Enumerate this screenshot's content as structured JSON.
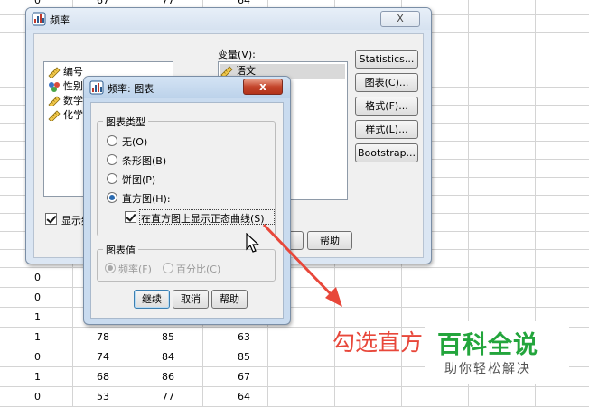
{
  "spreadsheet": {
    "top_partial": [
      "0",
      "67",
      "77",
      "64"
    ],
    "rows": [
      [
        "0",
        "",
        "",
        ""
      ],
      [
        "0",
        "",
        "",
        ""
      ],
      [
        "1",
        "",
        "",
        ""
      ],
      [
        "1",
        "78",
        "85",
        "63"
      ],
      [
        "0",
        "74",
        "84",
        "85"
      ],
      [
        "1",
        "68",
        "86",
        "67"
      ],
      [
        "0",
        "53",
        "77",
        "64"
      ]
    ]
  },
  "frequency_dialog": {
    "title": "频率",
    "close_label": "X",
    "source_vars": [
      {
        "label": "编号",
        "icon": "ruler-icon"
      },
      {
        "label": "性别",
        "icon": "nominal-icon"
      },
      {
        "label": "数学",
        "icon": "ruler-icon"
      },
      {
        "label": "化学",
        "icon": "ruler-icon"
      }
    ],
    "variables_label": "变量(V):",
    "target_vars": [
      {
        "label": "语文",
        "icon": "ruler-icon"
      }
    ],
    "side_buttons": [
      "Statistics...",
      "图表(C)...",
      "格式(F)...",
      "样式(L)...",
      "Bootstrap..."
    ],
    "show_freq_checkbox_label": "显示频",
    "help_label": "帮助"
  },
  "chart_dialog": {
    "title": "频率: 图表",
    "close_label": "x",
    "chart_type_group": "图表类型",
    "options": [
      {
        "label": "无(O)",
        "checked": false
      },
      {
        "label": "条形图(B)",
        "checked": false
      },
      {
        "label": "饼图(P)",
        "checked": false
      },
      {
        "label": "直方图(H):",
        "checked": true
      }
    ],
    "normal_curve_label": "在直方图上显示正态曲线(S)",
    "chart_values_group": "图表值",
    "value_options": [
      {
        "label": "频率(F)",
        "checked": true
      },
      {
        "label": "百分比(C)",
        "checked": false
      }
    ],
    "buttons": [
      "继续",
      "取消",
      "帮助"
    ]
  },
  "annotation": {
    "text": "勾选直方",
    "color": "#e8473a"
  },
  "watermark": {
    "title": "百科全说",
    "subtitle": "助你轻松解决",
    "color": "#23a53c"
  }
}
